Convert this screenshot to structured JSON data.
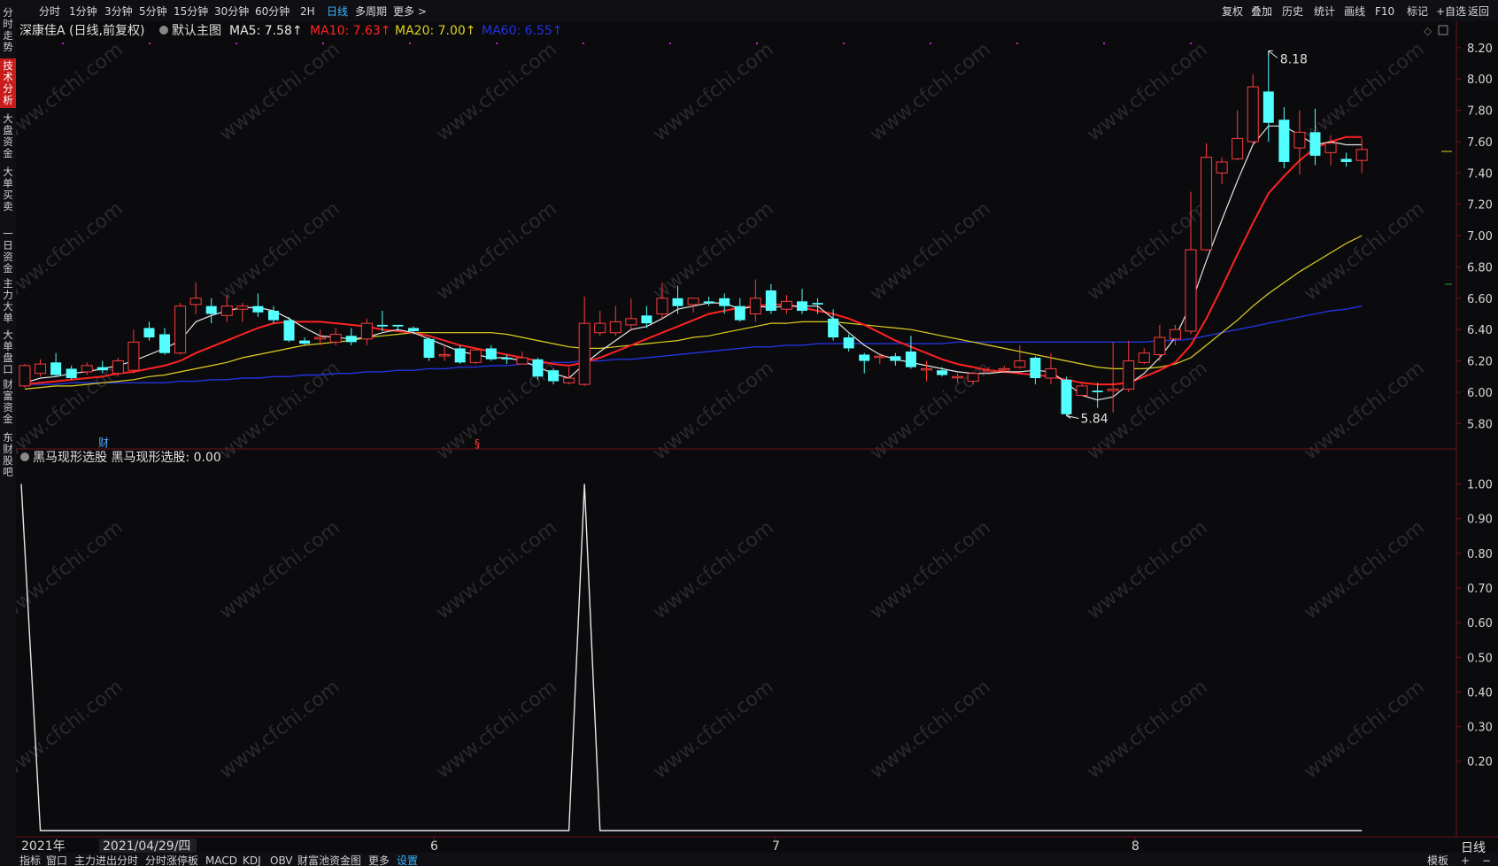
{
  "toolbar": {
    "periods": [
      "分时",
      "1分钟",
      "3分钟",
      "5分钟",
      "15分钟",
      "30分钟",
      "60分钟",
      "2H",
      "日线",
      "多周期",
      "更多 >"
    ],
    "active_period": "日线",
    "right": [
      "复权",
      "叠加",
      "历史",
      "统计",
      "画线",
      "F10",
      "标记",
      "+自选",
      "返回"
    ]
  },
  "left_tabs": [
    "分时走势",
    "技术分析",
    "大盘资金",
    "大单买卖",
    "一日资金",
    "主力大单",
    "大单盘口",
    "财富资金",
    "东财股吧"
  ],
  "active_tab": "技术分析",
  "main_header": {
    "stock": "深康佳A (日线,前复权)",
    "chart_name": "默认主图",
    "ma5": "MA5: 7.58↑",
    "ma10": "MA10: 7.63↑",
    "ma20": "MA20: 7.00↑",
    "ma60": "MA60: 6.55↑"
  },
  "sub_header": "黑马现形选股 黑马现形选股: 0.00",
  "annotations": {
    "high": "8.18",
    "low": "5.84",
    "marker_cai": "财",
    "marker_s": "§"
  },
  "x_axis": [
    "2021年",
    "2021/04/29/四",
    "6",
    "7",
    "8"
  ],
  "price_axis": [
    "8.20",
    "8.00",
    "7.80",
    "7.60",
    "7.40",
    "7.20",
    "7.00",
    "6.80",
    "6.60",
    "6.40",
    "6.20",
    "6.00",
    "5.80"
  ],
  "ind_axis": [
    "1.00",
    "0.90",
    "0.80",
    "0.70",
    "0.60",
    "0.50",
    "0.40",
    "0.30",
    "0.20"
  ],
  "bottom_tabs": [
    "指标",
    "窗口",
    "主力进出分时",
    "分时涨停板",
    "MACD",
    "KDJ",
    "OBV",
    "财富池资金图",
    "更多",
    "设置"
  ],
  "bottom_right": [
    "模板",
    "+",
    "−"
  ],
  "corner_label": "日线",
  "watermark": "www.cfchi.com",
  "colors": {
    "up": "#ff3c3c",
    "down": "#54ffff",
    "ma5": "#e6e6e6",
    "ma10": "#ff2222",
    "ma20": "#e0d020",
    "ma60": "#2233dd",
    "bg": "#0b0b0e",
    "grid": "#5a1010"
  },
  "chart_data": {
    "type": "candlestick",
    "ylim": [
      5.7,
      8.25
    ],
    "candles": [
      [
        6.04,
        6.17,
        6.03,
        6.18
      ],
      [
        6.12,
        6.18,
        6.1,
        6.21
      ],
      [
        6.19,
        6.11,
        6.1,
        6.25
      ],
      [
        6.15,
        6.09,
        6.08,
        6.17
      ],
      [
        6.13,
        6.17,
        6.11,
        6.19
      ],
      [
        6.16,
        6.14,
        6.12,
        6.2
      ],
      [
        6.12,
        6.2,
        6.1,
        6.22
      ],
      [
        6.14,
        6.32,
        6.12,
        6.4
      ],
      [
        6.41,
        6.35,
        6.33,
        6.45
      ],
      [
        6.37,
        6.25,
        6.24,
        6.41
      ],
      [
        6.25,
        6.55,
        6.24,
        6.57
      ],
      [
        6.56,
        6.6,
        6.5,
        6.7
      ],
      [
        6.55,
        6.5,
        6.44,
        6.6
      ],
      [
        6.49,
        6.55,
        6.45,
        6.62
      ],
      [
        6.53,
        6.55,
        6.45,
        6.57
      ],
      [
        6.55,
        6.51,
        6.48,
        6.63
      ],
      [
        6.52,
        6.46,
        6.44,
        6.55
      ],
      [
        6.46,
        6.33,
        6.32,
        6.48
      ],
      [
        6.33,
        6.31,
        6.3,
        6.35
      ],
      [
        6.34,
        6.35,
        6.3,
        6.4
      ],
      [
        6.32,
        6.37,
        6.3,
        6.41
      ],
      [
        6.36,
        6.32,
        6.3,
        6.41
      ],
      [
        6.34,
        6.44,
        6.3,
        6.47
      ],
      [
        6.43,
        6.42,
        6.39,
        6.52
      ],
      [
        6.43,
        6.42,
        6.39,
        6.43
      ],
      [
        6.41,
        6.39,
        6.37,
        6.42
      ],
      [
        6.34,
        6.22,
        6.2,
        6.35
      ],
      [
        6.24,
        6.24,
        6.2,
        6.3
      ],
      [
        6.28,
        6.19,
        6.18,
        6.3
      ],
      [
        6.19,
        6.27,
        6.18,
        6.28
      ],
      [
        6.28,
        6.21,
        6.2,
        6.3
      ],
      [
        6.22,
        6.21,
        6.18,
        6.24
      ],
      [
        6.18,
        6.22,
        6.18,
        6.26
      ],
      [
        6.21,
        6.1,
        6.08,
        6.22
      ],
      [
        6.14,
        6.07,
        6.05,
        6.15
      ],
      [
        6.06,
        6.09,
        6.05,
        6.16
      ],
      [
        6.05,
        6.44,
        6.04,
        6.61
      ],
      [
        6.38,
        6.44,
        6.36,
        6.52
      ],
      [
        6.38,
        6.45,
        6.36,
        6.55
      ],
      [
        6.43,
        6.47,
        6.4,
        6.6
      ],
      [
        6.49,
        6.44,
        6.41,
        6.55
      ],
      [
        6.5,
        6.6,
        6.47,
        6.7
      ],
      [
        6.6,
        6.55,
        6.5,
        6.68
      ],
      [
        6.56,
        6.6,
        6.51,
        6.6
      ],
      [
        6.58,
        6.57,
        6.55,
        6.61
      ],
      [
        6.6,
        6.55,
        6.5,
        6.63
      ],
      [
        6.55,
        6.46,
        6.45,
        6.6
      ],
      [
        6.5,
        6.6,
        6.45,
        6.72
      ],
      [
        6.65,
        6.52,
        6.5,
        6.69
      ],
      [
        6.53,
        6.58,
        6.5,
        6.62
      ],
      [
        6.58,
        6.52,
        6.5,
        6.66
      ],
      [
        6.57,
        6.56,
        6.5,
        6.6
      ],
      [
        6.47,
        6.35,
        6.33,
        6.53
      ],
      [
        6.35,
        6.28,
        6.26,
        6.37
      ],
      [
        6.24,
        6.2,
        6.12,
        6.25
      ],
      [
        6.23,
        6.23,
        6.18,
        6.25
      ],
      [
        6.23,
        6.2,
        6.17,
        6.25
      ],
      [
        6.26,
        6.16,
        6.15,
        6.36
      ],
      [
        6.15,
        6.15,
        6.07,
        6.2
      ],
      [
        6.14,
        6.11,
        6.1,
        6.16
      ],
      [
        6.1,
        6.1,
        6.06,
        6.12
      ],
      [
        6.07,
        6.12,
        6.05,
        6.13
      ],
      [
        6.13,
        6.14,
        6.13,
        6.16
      ],
      [
        6.15,
        6.15,
        6.12,
        6.17
      ],
      [
        6.16,
        6.2,
        6.15,
        6.3
      ],
      [
        6.22,
        6.09,
        6.05,
        6.23
      ],
      [
        6.09,
        6.15,
        6.05,
        6.25
      ],
      [
        6.08,
        5.86,
        5.85,
        6.1
      ],
      [
        5.98,
        6.04,
        5.98,
        6.06
      ],
      [
        6.01,
        6.0,
        5.9,
        6.06
      ],
      [
        6.01,
        6.02,
        5.87,
        6.32
      ],
      [
        6.02,
        6.2,
        6.0,
        6.33
      ],
      [
        6.19,
        6.25,
        6.18,
        6.28
      ],
      [
        6.24,
        6.35,
        6.2,
        6.43
      ],
      [
        6.34,
        6.4,
        6.3,
        6.43
      ],
      [
        6.39,
        6.91,
        6.37,
        7.28
      ],
      [
        6.91,
        7.5,
        6.9,
        7.59
      ],
      [
        7.4,
        7.47,
        7.33,
        7.5
      ],
      [
        7.49,
        7.62,
        7.48,
        7.8
      ],
      [
        7.6,
        7.95,
        7.58,
        8.03
      ],
      [
        7.92,
        7.72,
        7.6,
        8.18
      ],
      [
        7.74,
        7.47,
        7.43,
        7.82
      ],
      [
        7.56,
        7.66,
        7.39,
        7.8
      ],
      [
        7.66,
        7.51,
        7.45,
        7.81
      ],
      [
        7.53,
        7.59,
        7.45,
        7.64
      ],
      [
        7.49,
        7.47,
        7.44,
        7.53
      ],
      [
        7.48,
        7.55,
        7.4,
        7.62
      ]
    ],
    "ma5": [
      6.06,
      6.09,
      6.1,
      6.12,
      6.13,
      6.15,
      6.17,
      6.2,
      6.24,
      6.28,
      6.33,
      6.45,
      6.49,
      6.52,
      6.54,
      6.54,
      6.52,
      6.47,
      6.41,
      6.36,
      6.35,
      6.34,
      6.35,
      6.38,
      6.4,
      6.38,
      6.34,
      6.3,
      6.26,
      6.24,
      6.22,
      6.22,
      6.2,
      6.16,
      6.12,
      6.09,
      6.18,
      6.26,
      6.33,
      6.4,
      6.42,
      6.47,
      6.53,
      6.55,
      6.57,
      6.57,
      6.53,
      6.55,
      6.54,
      6.55,
      6.55,
      6.55,
      6.47,
      6.38,
      6.3,
      6.24,
      6.21,
      6.19,
      6.17,
      6.15,
      6.13,
      6.12,
      6.12,
      6.13,
      6.13,
      6.14,
      6.13,
      6.06,
      5.98,
      5.95,
      5.97,
      6.05,
      6.12,
      6.22,
      6.35,
      6.56,
      6.84,
      7.1,
      7.35,
      7.58,
      7.7,
      7.7,
      7.64,
      7.58,
      7.6,
      7.58,
      7.58
    ],
    "ma10": [
      6.05,
      6.06,
      6.07,
      6.08,
      6.09,
      6.1,
      6.12,
      6.13,
      6.15,
      6.17,
      6.2,
      6.25,
      6.29,
      6.33,
      6.37,
      6.41,
      6.44,
      6.45,
      6.45,
      6.45,
      6.44,
      6.43,
      6.42,
      6.4,
      6.39,
      6.38,
      6.36,
      6.33,
      6.3,
      6.28,
      6.26,
      6.24,
      6.22,
      6.2,
      6.18,
      6.17,
      6.19,
      6.22,
      6.26,
      6.3,
      6.34,
      6.38,
      6.42,
      6.46,
      6.5,
      6.52,
      6.54,
      6.55,
      6.56,
      6.56,
      6.54,
      6.52,
      6.5,
      6.47,
      6.43,
      6.38,
      6.33,
      6.29,
      6.25,
      6.21,
      6.18,
      6.16,
      6.14,
      6.13,
      6.12,
      6.11,
      6.1,
      6.08,
      6.06,
      6.05,
      6.05,
      6.06,
      6.1,
      6.14,
      6.19,
      6.3,
      6.47,
      6.67,
      6.88,
      7.08,
      7.27,
      7.38,
      7.48,
      7.56,
      7.6,
      7.63,
      7.63
    ],
    "ma20": [
      6.02,
      6.03,
      6.04,
      6.04,
      6.05,
      6.06,
      6.07,
      6.08,
      6.1,
      6.11,
      6.13,
      6.15,
      6.17,
      6.19,
      6.22,
      6.24,
      6.26,
      6.28,
      6.3,
      6.31,
      6.32,
      6.33,
      6.35,
      6.36,
      6.37,
      6.38,
      6.38,
      6.38,
      6.38,
      6.38,
      6.38,
      6.37,
      6.35,
      6.33,
      6.31,
      6.29,
      6.28,
      6.28,
      6.29,
      6.3,
      6.31,
      6.32,
      6.33,
      6.35,
      6.36,
      6.38,
      6.4,
      6.42,
      6.44,
      6.44,
      6.45,
      6.45,
      6.45,
      6.44,
      6.43,
      6.42,
      6.41,
      6.4,
      6.38,
      6.36,
      6.34,
      6.32,
      6.3,
      6.28,
      6.26,
      6.24,
      6.22,
      6.2,
      6.18,
      6.16,
      6.15,
      6.15,
      6.15,
      6.16,
      6.18,
      6.22,
      6.3,
      6.38,
      6.46,
      6.55,
      6.63,
      6.7,
      6.77,
      6.83,
      6.89,
      6.95,
      7.0
    ],
    "ma60": [
      6.05,
      6.05,
      6.05,
      6.06,
      6.06,
      6.06,
      6.06,
      6.06,
      6.06,
      6.06,
      6.07,
      6.07,
      6.08,
      6.08,
      6.09,
      6.09,
      6.1,
      6.1,
      6.11,
      6.11,
      6.12,
      6.12,
      6.13,
      6.13,
      6.14,
      6.14,
      6.15,
      6.15,
      6.16,
      6.16,
      6.17,
      6.17,
      6.18,
      6.18,
      6.19,
      6.19,
      6.2,
      6.2,
      6.21,
      6.21,
      6.22,
      6.23,
      6.24,
      6.25,
      6.26,
      6.27,
      6.28,
      6.29,
      6.29,
      6.3,
      6.3,
      6.31,
      6.31,
      6.31,
      6.31,
      6.31,
      6.31,
      6.31,
      6.31,
      6.31,
      6.32,
      6.32,
      6.32,
      6.32,
      6.32,
      6.32,
      6.32,
      6.32,
      6.32,
      6.32,
      6.32,
      6.32,
      6.32,
      6.33,
      6.33,
      6.34,
      6.36,
      6.38,
      6.4,
      6.42,
      6.44,
      6.46,
      6.48,
      6.5,
      6.52,
      6.53,
      6.55
    ],
    "indicator": {
      "name": "黑马现形选股",
      "ylim": [
        0,
        1.05
      ],
      "values_note": "1.00 at first bar, spike to 1.00 at bar 36, otherwise 0"
    }
  }
}
